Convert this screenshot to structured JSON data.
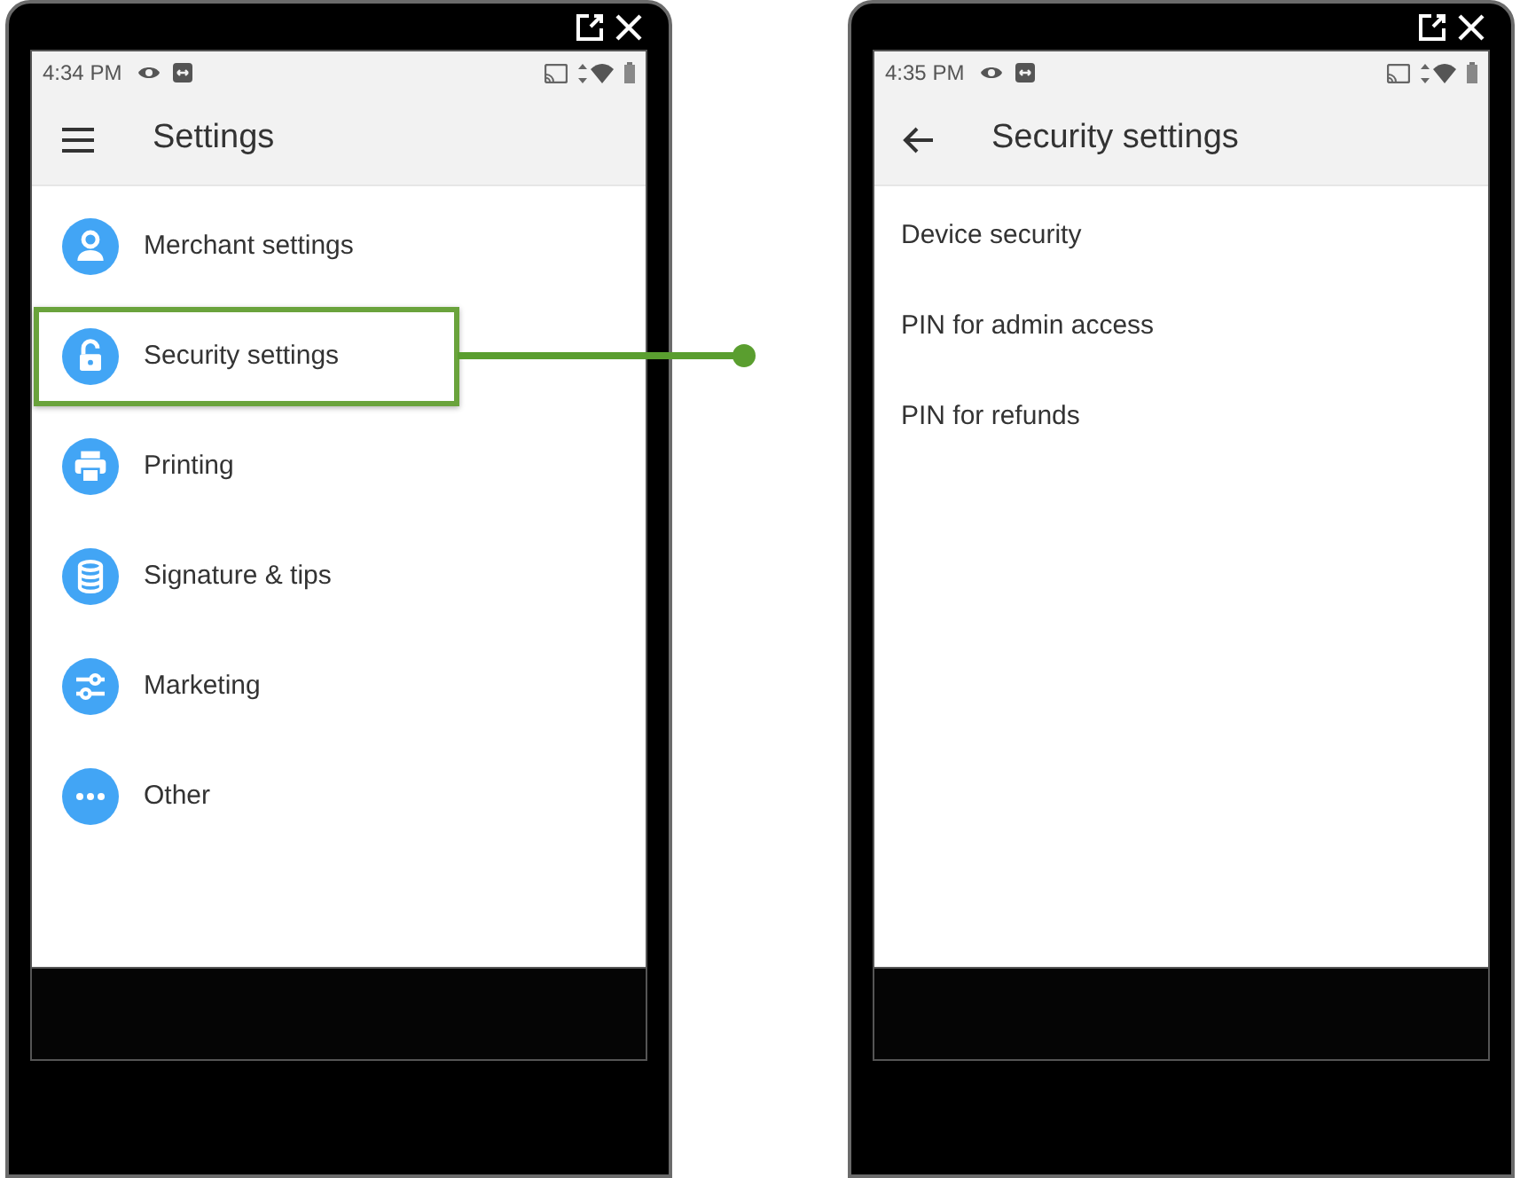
{
  "phones": [
    {
      "kind": "menu",
      "status_bar": {
        "time": "4:34 PM"
      },
      "app_bar": {
        "title": "Settings"
      },
      "items": [
        {
          "label": "Merchant settings",
          "selected": false
        },
        {
          "label": "Security settings",
          "selected": true
        },
        {
          "label": "Printing",
          "selected": false
        },
        {
          "label": "Signature & tips",
          "selected": false
        },
        {
          "label": "Marketing",
          "selected": false
        },
        {
          "label": "Other",
          "selected": false
        }
      ]
    },
    {
      "kind": "detail",
      "status_bar": {
        "time": "4:35 PM"
      },
      "app_bar": {
        "title": "Security settings"
      },
      "items": [
        {
          "label": "Device security"
        },
        {
          "label": "PIN for admin access"
        },
        {
          "label": "PIN for refunds"
        }
      ]
    }
  ]
}
